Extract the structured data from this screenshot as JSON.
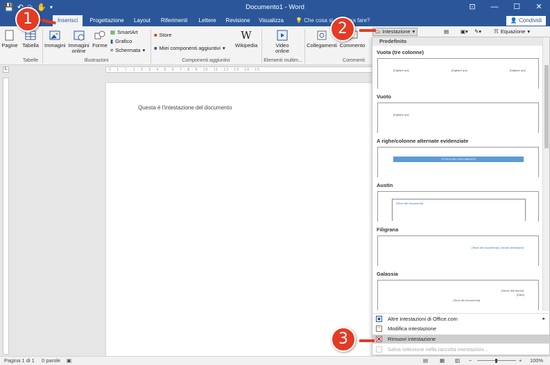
{
  "window": {
    "title": "Documento1 - Word",
    "min_glyph": "—",
    "max_glyph": "☐",
    "close_glyph": "✕",
    "ribbon_opts_glyph": "⊡"
  },
  "tabs": [
    {
      "label": "Inserisci",
      "active": true
    },
    {
      "label": "Progettazione"
    },
    {
      "label": "Layout"
    },
    {
      "label": "Riferimenti"
    },
    {
      "label": "Lettere"
    },
    {
      "label": "Revisione"
    },
    {
      "label": "Visualizza"
    }
  ],
  "tell_me": "Che cosa si desidera fare?",
  "share_label": "Condividi",
  "ribbon": {
    "pages": "Pagine",
    "table": "Tabella",
    "images": "Immagini",
    "online_images": "Immagini online",
    "shapes": "Forme",
    "smartart": "SmartArt",
    "chart": "Grafico",
    "screenshot": "Schermata",
    "store": "Store",
    "my_addins": "Miei componenti aggiuntivi",
    "wikipedia": "Wikipedia",
    "online_video": "Video online",
    "links": "Collegamenti",
    "comment": "Commento",
    "header_button": "Intestazione",
    "equation": "Equazione",
    "groups": {
      "tables": "Tabelle",
      "illustrations": "Illustrazioni",
      "addins": "Componenti aggiuntivi",
      "multimedia": "Elementi multim...",
      "comments": "Commenti"
    }
  },
  "document": {
    "header_text": "Questa è l'intestazione del documento"
  },
  "gallery": {
    "section": "Predefinito",
    "templates": [
      {
        "name": "Vuota (tre colonne)",
        "placeholders": [
          "[Digitare qui]",
          "[Digitare qui]",
          "[Digitare qui]"
        ]
      },
      {
        "name": "Vuoto",
        "placeholders": [
          "[Digitare qui]"
        ]
      },
      {
        "name": "A righe/colonne alternate evidenziate",
        "placeholders": [
          "TITOLO DEL DOCUMENTO"
        ]
      },
      {
        "name": "Austin",
        "placeholders": [
          "[Titolo del documento]"
        ]
      },
      {
        "name": "Filigrana",
        "placeholders": [
          "[Titolo del documento] | [Nome dell'autore]"
        ]
      },
      {
        "name": "Galassia",
        "placeholders": [
          "[Nome dell'autore]",
          "[Data]",
          "[Titolo del documento]"
        ]
      }
    ]
  },
  "menu": [
    {
      "label": "Altre intestazioni di Office.com",
      "has_submenu": true
    },
    {
      "label": "Modifica intestazione"
    },
    {
      "label": "Rimuovi intestazione",
      "hover": true
    },
    {
      "label": "Salva selezione nella raccolta intestazioni...",
      "disabled": true
    }
  ],
  "status": {
    "page": "Pagina 1 di 1",
    "words": "0 parole",
    "zoom": "100%"
  },
  "callouts": [
    "1",
    "2",
    "3"
  ],
  "colors": {
    "accent": "#2b579a",
    "callout": "#e53a24"
  }
}
